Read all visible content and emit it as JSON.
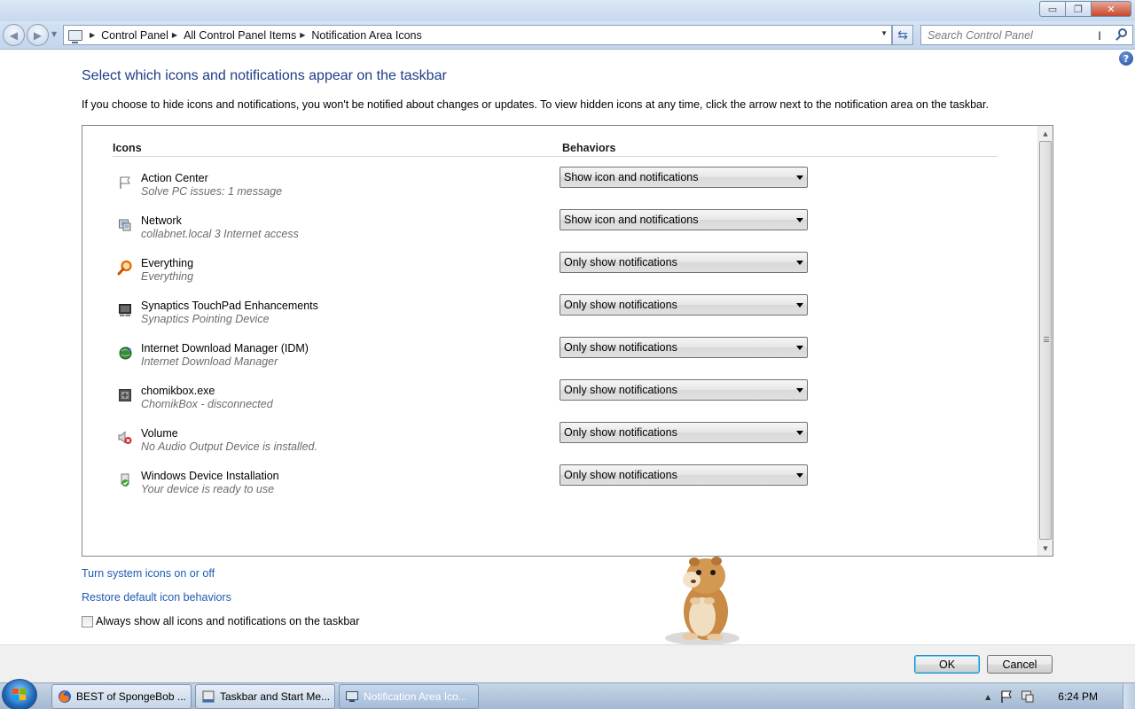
{
  "window": {
    "minimize_glyph": "▭",
    "restore_glyph": "❐",
    "close_glyph": "✕"
  },
  "address_bar": {
    "breadcrumbs": [
      "Control Panel",
      "All Control Panel Items",
      "Notification Area Icons"
    ],
    "search_placeholder": "Search Control Panel"
  },
  "page": {
    "title": "Select which icons and notifications appear on the taskbar",
    "description": "If you choose to hide icons and notifications, you won't be notified about changes or updates. To view hidden icons at any time, click the arrow next to the notification area on the taskbar.",
    "help_glyph": "?"
  },
  "list": {
    "col_icons": "Icons",
    "col_behaviors": "Behaviors",
    "rows": [
      {
        "icon": "flag-icon",
        "name": "Action Center",
        "subtitle": "Solve PC issues: 1 message",
        "behavior": "Show icon and notifications"
      },
      {
        "icon": "network-icon",
        "name": "Network",
        "subtitle": "collabnet.local  3 Internet access",
        "behavior": "Show icon and notifications"
      },
      {
        "icon": "search-icon",
        "name": "Everything",
        "subtitle": "Everything",
        "behavior": "Only show notifications"
      },
      {
        "icon": "touchpad-icon",
        "name": "Synaptics TouchPad Enhancements",
        "subtitle": "Synaptics Pointing Device",
        "behavior": "Only show notifications"
      },
      {
        "icon": "globe-download-icon",
        "name": "Internet Download Manager (IDM)",
        "subtitle": "Internet Download Manager",
        "behavior": "Only show notifications"
      },
      {
        "icon": "chomikbox-icon",
        "name": "chomikbox.exe",
        "subtitle": "ChomikBox - disconnected",
        "behavior": "Only show notifications"
      },
      {
        "icon": "volume-muted-icon",
        "name": "Volume",
        "subtitle": "No Audio Output Device is installed.",
        "behavior": "Only show notifications"
      },
      {
        "icon": "device-install-icon",
        "name": "Windows Device Installation",
        "subtitle": "Your device is ready to use",
        "behavior": "Only show notifications"
      }
    ]
  },
  "links": {
    "system_icons": "Turn system icons on or off",
    "restore_defaults": "Restore default icon behaviors"
  },
  "checkbox": {
    "label": "Always show all icons and notifications on the taskbar",
    "checked": false
  },
  "buttons": {
    "ok": "OK",
    "cancel": "Cancel"
  },
  "taskbar": {
    "items": [
      {
        "label": "BEST of SpongeBob ...",
        "icon": "firefox-icon",
        "active": false
      },
      {
        "label": "Taskbar and Start Me...",
        "icon": "taskbar-properties-icon",
        "active": false
      },
      {
        "label": "Notification Area Ico...",
        "icon": "control-panel-icon",
        "active": true
      }
    ],
    "clock": "6:24 PM"
  },
  "colors": {
    "title_blue": "#1e3d87",
    "link_blue": "#1e5ab4",
    "chrome_blue": "#c7d9ee"
  }
}
